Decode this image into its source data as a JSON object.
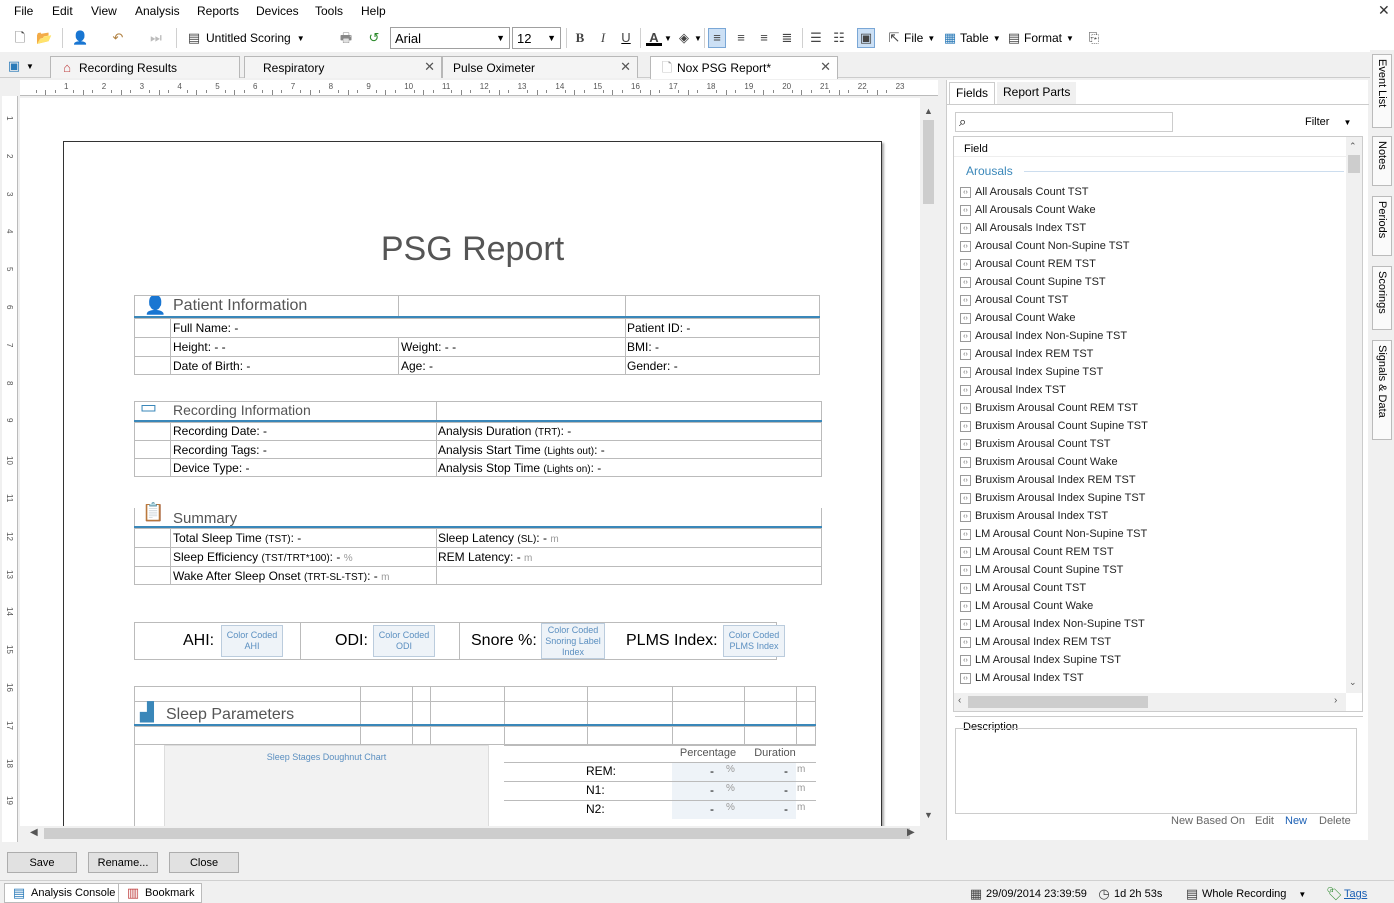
{
  "menu": [
    "File",
    "Edit",
    "View",
    "Analysis",
    "Reports",
    "Devices",
    "Tools",
    "Help"
  ],
  "toolbar": {
    "scoring_label": "Untitled Scoring",
    "font_value": "Arial",
    "size_value": "12",
    "file_label": "File",
    "table_label": "Table",
    "format_label": "Format"
  },
  "tabs": [
    {
      "label": "Recording Results"
    },
    {
      "label": "Respiratory"
    },
    {
      "label": "Pulse Oximeter"
    },
    {
      "label": "Nox PSG Report*"
    }
  ],
  "ruler_ticks": [
    "1",
    "2",
    "3",
    "4",
    "5",
    "6",
    "7",
    "8",
    "9",
    "10",
    "11",
    "12",
    "13",
    "14",
    "15",
    "16",
    "17",
    "18",
    "19",
    "20",
    "21",
    "22",
    "23"
  ],
  "vruler_ticks": [
    "1",
    "2",
    "3",
    "4",
    "5",
    "6",
    "7",
    "8",
    "9",
    "10",
    "11",
    "12",
    "13",
    "14",
    "15",
    "16",
    "17",
    "18",
    "19"
  ],
  "report": {
    "title": "PSG Report",
    "patient": {
      "header": "Patient Information",
      "full_name": "Full Name: -",
      "patient_id": "Patient ID: -",
      "height": "Height: - -",
      "weight": "Weight: - -",
      "bmi": "BMI: -",
      "dob": "Date of Birth: -",
      "age": "Age: -",
      "gender": "Gender: -"
    },
    "recording": {
      "header": "Recording Information",
      "date": "Recording Date: -",
      "duration_pre": "Analysis Duration ",
      "duration_small": "(TRT)",
      "duration_post": ": -",
      "tags": "Recording Tags: -",
      "start_pre": "Analysis Start Time ",
      "start_small": "(Lights out)",
      "start_post": ": -",
      "device": "Device Type: -",
      "stop_pre": "Analysis Stop Time ",
      "stop_small": "(Lights on)",
      "stop_post": ": -"
    },
    "summary": {
      "header": "Summary",
      "tst_pre": "Total Sleep Time ",
      "tst_small": "(TST)",
      "tst_post": ": -",
      "sl_pre": "Sleep Latency ",
      "sl_small": "(SL)",
      "sl_post": ": -",
      "sl_unit": "m",
      "se_pre": "Sleep Efficiency ",
      "se_small": "(TST/TRT*100)",
      "se_post": ": -",
      "se_unit": "%",
      "rem": "REM Latency: -",
      "rem_unit": "m",
      "waso_pre": "Wake After Sleep Onset ",
      "waso_small": "(TRT-SL-TST)",
      "waso_post": ": -",
      "waso_unit": "m"
    },
    "indices": {
      "ahi": "AHI:",
      "ahi_cc": "Color Coded AHI",
      "odi": "ODI:",
      "odi_cc": "Color Coded ODI",
      "snore": "Snore %:",
      "snore_cc": "Color Coded Snoring Label Index",
      "plms": "PLMS Index:",
      "plms_cc": "Color Coded PLMS Index"
    },
    "sleep": {
      "header": "Sleep Parameters",
      "chart": "Sleep Stages Doughnut Chart",
      "col_pct": "Percentage",
      "col_dur": "Duration",
      "rows": [
        {
          "stage": "REM:",
          "pct": "-",
          "pct_unit": "%",
          "dur": "-",
          "dur_unit": "m"
        },
        {
          "stage": "N1:",
          "pct": "-",
          "pct_unit": "%",
          "dur": "-",
          "dur_unit": "m"
        },
        {
          "stage": "N2:",
          "pct": "-",
          "pct_unit": "%",
          "dur": "-",
          "dur_unit": "m"
        }
      ]
    }
  },
  "panel": {
    "tab_fields": "Fields",
    "tab_parts": "Report Parts",
    "filter": "Filter",
    "col_field": "Field",
    "group": "Arousals",
    "items": [
      "All Arousals Count TST",
      "All Arousals Count Wake",
      "All Arousals Index TST",
      "Arousal Count Non-Supine TST",
      "Arousal Count REM TST",
      "Arousal Count Supine TST",
      "Arousal Count TST",
      "Arousal Count Wake",
      "Arousal Index Non-Supine TST",
      "Arousal Index REM TST",
      "Arousal Index Supine TST",
      "Arousal Index TST",
      "Bruxism Arousal Count REM TST",
      "Bruxism Arousal Count Supine TST",
      "Bruxism Arousal Count TST",
      "Bruxism Arousal Count Wake",
      "Bruxism Arousal Index REM TST",
      "Bruxism Arousal Index Supine TST",
      "Bruxism Arousal Index TST",
      "LM Arousal Count Non-Supine TST",
      "LM Arousal Count REM TST",
      "LM Arousal Count Supine TST",
      "LM Arousal Count TST",
      "LM Arousal Count Wake",
      "LM Arousal Index Non-Supine TST",
      "LM Arousal Index REM TST",
      "LM Arousal Index Supine TST",
      "LM Arousal Index TST"
    ],
    "description": "Description",
    "new_based_on": "New Based On",
    "edit": "Edit",
    "new": "New",
    "delete": "Delete"
  },
  "sidebar": [
    "Event List",
    "Notes",
    "Periods",
    "Scorings",
    "Signals & Data"
  ],
  "buttons": {
    "save": "Save",
    "rename": "Rename...",
    "close": "Close"
  },
  "status": {
    "analysis_console": "Analysis Console",
    "bookmark": "Bookmark",
    "datetime": "29/09/2014 23:39:59",
    "duration": "1d 2h 53s",
    "range": "Whole Recording",
    "tags": "Tags"
  },
  "colors": {
    "accent": "#3a87b9",
    "link": "#1a5fb4"
  }
}
